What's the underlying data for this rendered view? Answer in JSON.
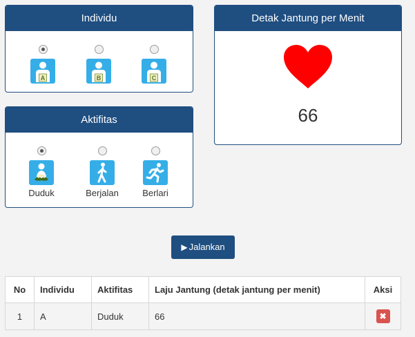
{
  "individu_panel": {
    "title": "Individu",
    "options": [
      {
        "letter": "A",
        "selected": true
      },
      {
        "letter": "B",
        "selected": false
      },
      {
        "letter": "C",
        "selected": false
      }
    ]
  },
  "aktifitas_panel": {
    "title": "Aktifitas",
    "options": [
      {
        "label": "Duduk",
        "icon": "sitting-person-icon",
        "selected": true
      },
      {
        "label": "Berjalan",
        "icon": "walking-person-icon",
        "selected": false
      },
      {
        "label": "Berlari",
        "icon": "running-person-icon",
        "selected": false
      }
    ]
  },
  "heart_panel": {
    "title": "Detak Jantung per Menit",
    "value": "66",
    "icon": "heart-icon",
    "heart_color": "#ff0000"
  },
  "run_button": {
    "label": "Jalankan",
    "icon": "play-icon"
  },
  "table": {
    "headers": [
      "No",
      "Individu",
      "Aktifitas",
      "Laju Jantung (detak jantung per menit)",
      "Aksi"
    ],
    "rows": [
      {
        "no": "1",
        "individu": "A",
        "aktifitas": "Duduk",
        "laju": "66",
        "action_icon": "delete-icon"
      }
    ]
  },
  "colors": {
    "primary": "#1f4e80",
    "tile": "#35aee8",
    "danger": "#d9534f"
  }
}
